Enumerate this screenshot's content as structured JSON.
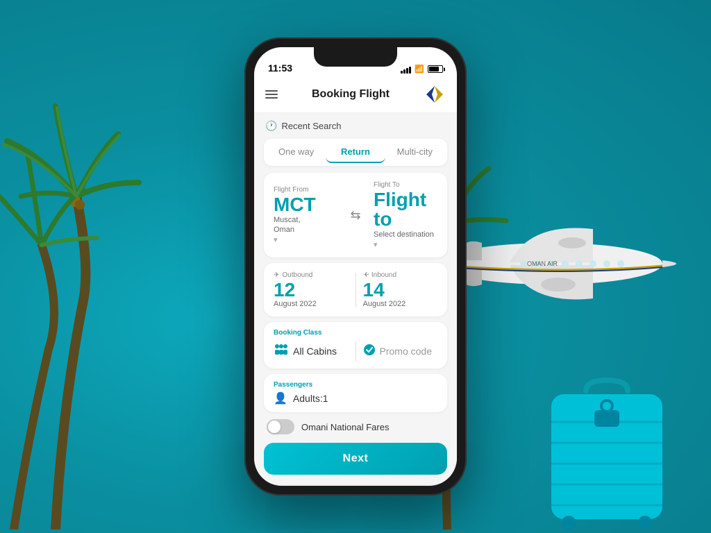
{
  "background": {
    "color": "#0a9aaa"
  },
  "phone": {
    "status_bar": {
      "time": "11:53"
    },
    "header": {
      "title": "Booking Flight",
      "menu_icon": "☰"
    },
    "recent_search": {
      "label": "Recent Search"
    },
    "tabs": [
      {
        "label": "One way",
        "active": false
      },
      {
        "label": "Return",
        "active": true
      },
      {
        "label": "Multi-city",
        "active": false
      }
    ],
    "flight_from": {
      "label": "Flight From",
      "code": "MCT",
      "city": "Muscat,",
      "country": "Oman"
    },
    "flight_to": {
      "label": "Flight To",
      "code": "Flight to",
      "destination": "Select destination"
    },
    "outbound": {
      "label": "Outbound",
      "day": "12",
      "month": "August 2022"
    },
    "inbound": {
      "label": "Inbound",
      "day": "14",
      "month": "August 2022"
    },
    "booking_class": {
      "label": "Booking Class",
      "class_value": "All Cabins",
      "promo_label": "Promo code"
    },
    "passengers": {
      "label": "Passengers",
      "value": "Adults:1"
    },
    "toggle": {
      "label": "Omani National Fares"
    },
    "next_button": {
      "label": "Next"
    }
  }
}
